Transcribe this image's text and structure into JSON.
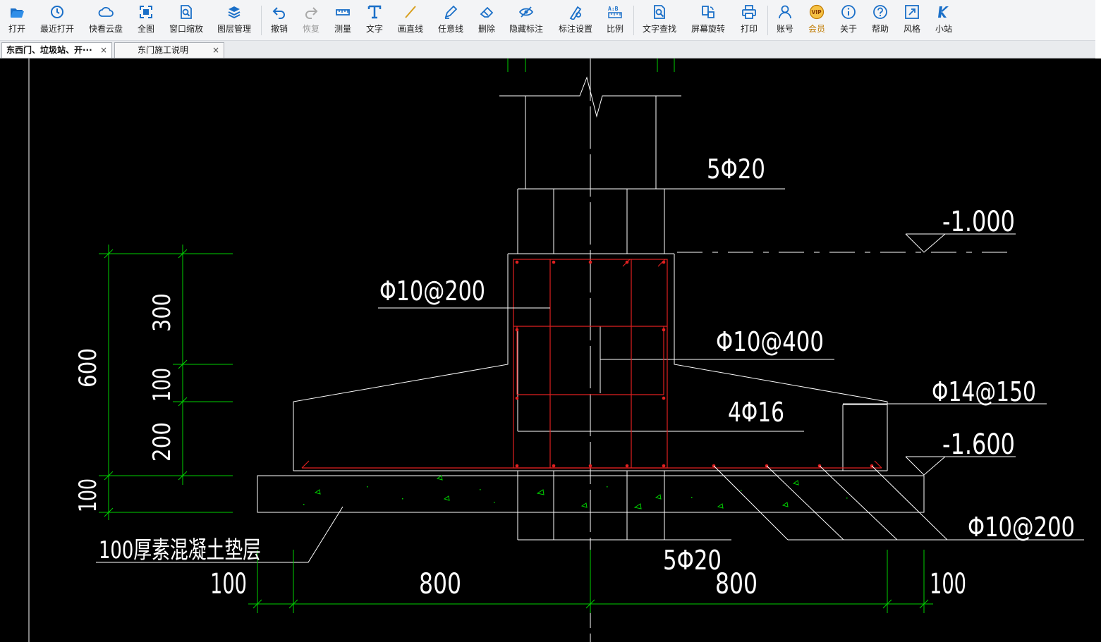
{
  "toolbar": {
    "items": [
      {
        "label": "打开",
        "icon": "open-folder-icon"
      },
      {
        "label": "最近打开",
        "icon": "recent-clock-icon"
      },
      {
        "label": "快看云盘",
        "icon": "cloud-icon"
      },
      {
        "label": "全图",
        "icon": "fit-all-icon"
      },
      {
        "label": "窗口缩放",
        "icon": "window-zoom-icon"
      },
      {
        "label": "图层管理",
        "icon": "layers-icon"
      },
      {
        "label": "撤销",
        "icon": "undo-icon"
      },
      {
        "label": "恢复",
        "icon": "redo-icon"
      },
      {
        "label": "测量",
        "icon": "measure-icon"
      },
      {
        "label": "文字",
        "icon": "text-icon"
      },
      {
        "label": "画直线",
        "icon": "line-icon"
      },
      {
        "label": "任意线",
        "icon": "freehand-pen-icon"
      },
      {
        "label": "删除",
        "icon": "eraser-icon"
      },
      {
        "label": "隐藏标注",
        "icon": "hide-eye-icon"
      },
      {
        "label": "标注设置",
        "icon": "annotation-settings-icon"
      },
      {
        "label": "比例",
        "icon": "scale-icon"
      },
      {
        "label": "文字查找",
        "icon": "text-search-icon"
      },
      {
        "label": "屏幕旋转",
        "icon": "rotate-screen-icon"
      },
      {
        "label": "打印",
        "icon": "printer-icon"
      },
      {
        "label": "账号",
        "icon": "user-icon"
      },
      {
        "label": "会员",
        "icon": "vip-badge-icon"
      },
      {
        "label": "关于",
        "icon": "info-icon"
      },
      {
        "label": "帮助",
        "icon": "help-icon"
      },
      {
        "label": "风格",
        "icon": "style-arrow-icon"
      },
      {
        "label": "小站",
        "icon": "k-logo-icon"
      }
    ]
  },
  "tabs": [
    {
      "label": "东西门、垃圾站、开···",
      "close": "×"
    },
    {
      "label": "东门施工说明",
      "close": "×"
    }
  ],
  "drawing": {
    "labels": {
      "top_bars": "5Φ20",
      "elev_top": "-1.000",
      "stirrup_left": "Φ10@200",
      "stirrup_mid": "Φ10@400",
      "middle_bars": "4Φ16",
      "slab_top_bars": "Φ14@150",
      "elev_bottom": "-1.600",
      "slab_bottom_bars": "Φ10@200",
      "bottom_bars": "5Φ20",
      "cushion": "100厚素混凝土垫层"
    },
    "dims": {
      "v_total": "600",
      "v_300": "300",
      "v_100": "100",
      "v_200": "200",
      "v_cushion": "100",
      "h_left": "100",
      "h_800_left": "800",
      "h_800_right": "800",
      "h_right": "100"
    },
    "colors": {
      "background": "#000000",
      "structure": "#ffffff",
      "rebar": "#e02020",
      "dimension": "#00d000"
    }
  }
}
